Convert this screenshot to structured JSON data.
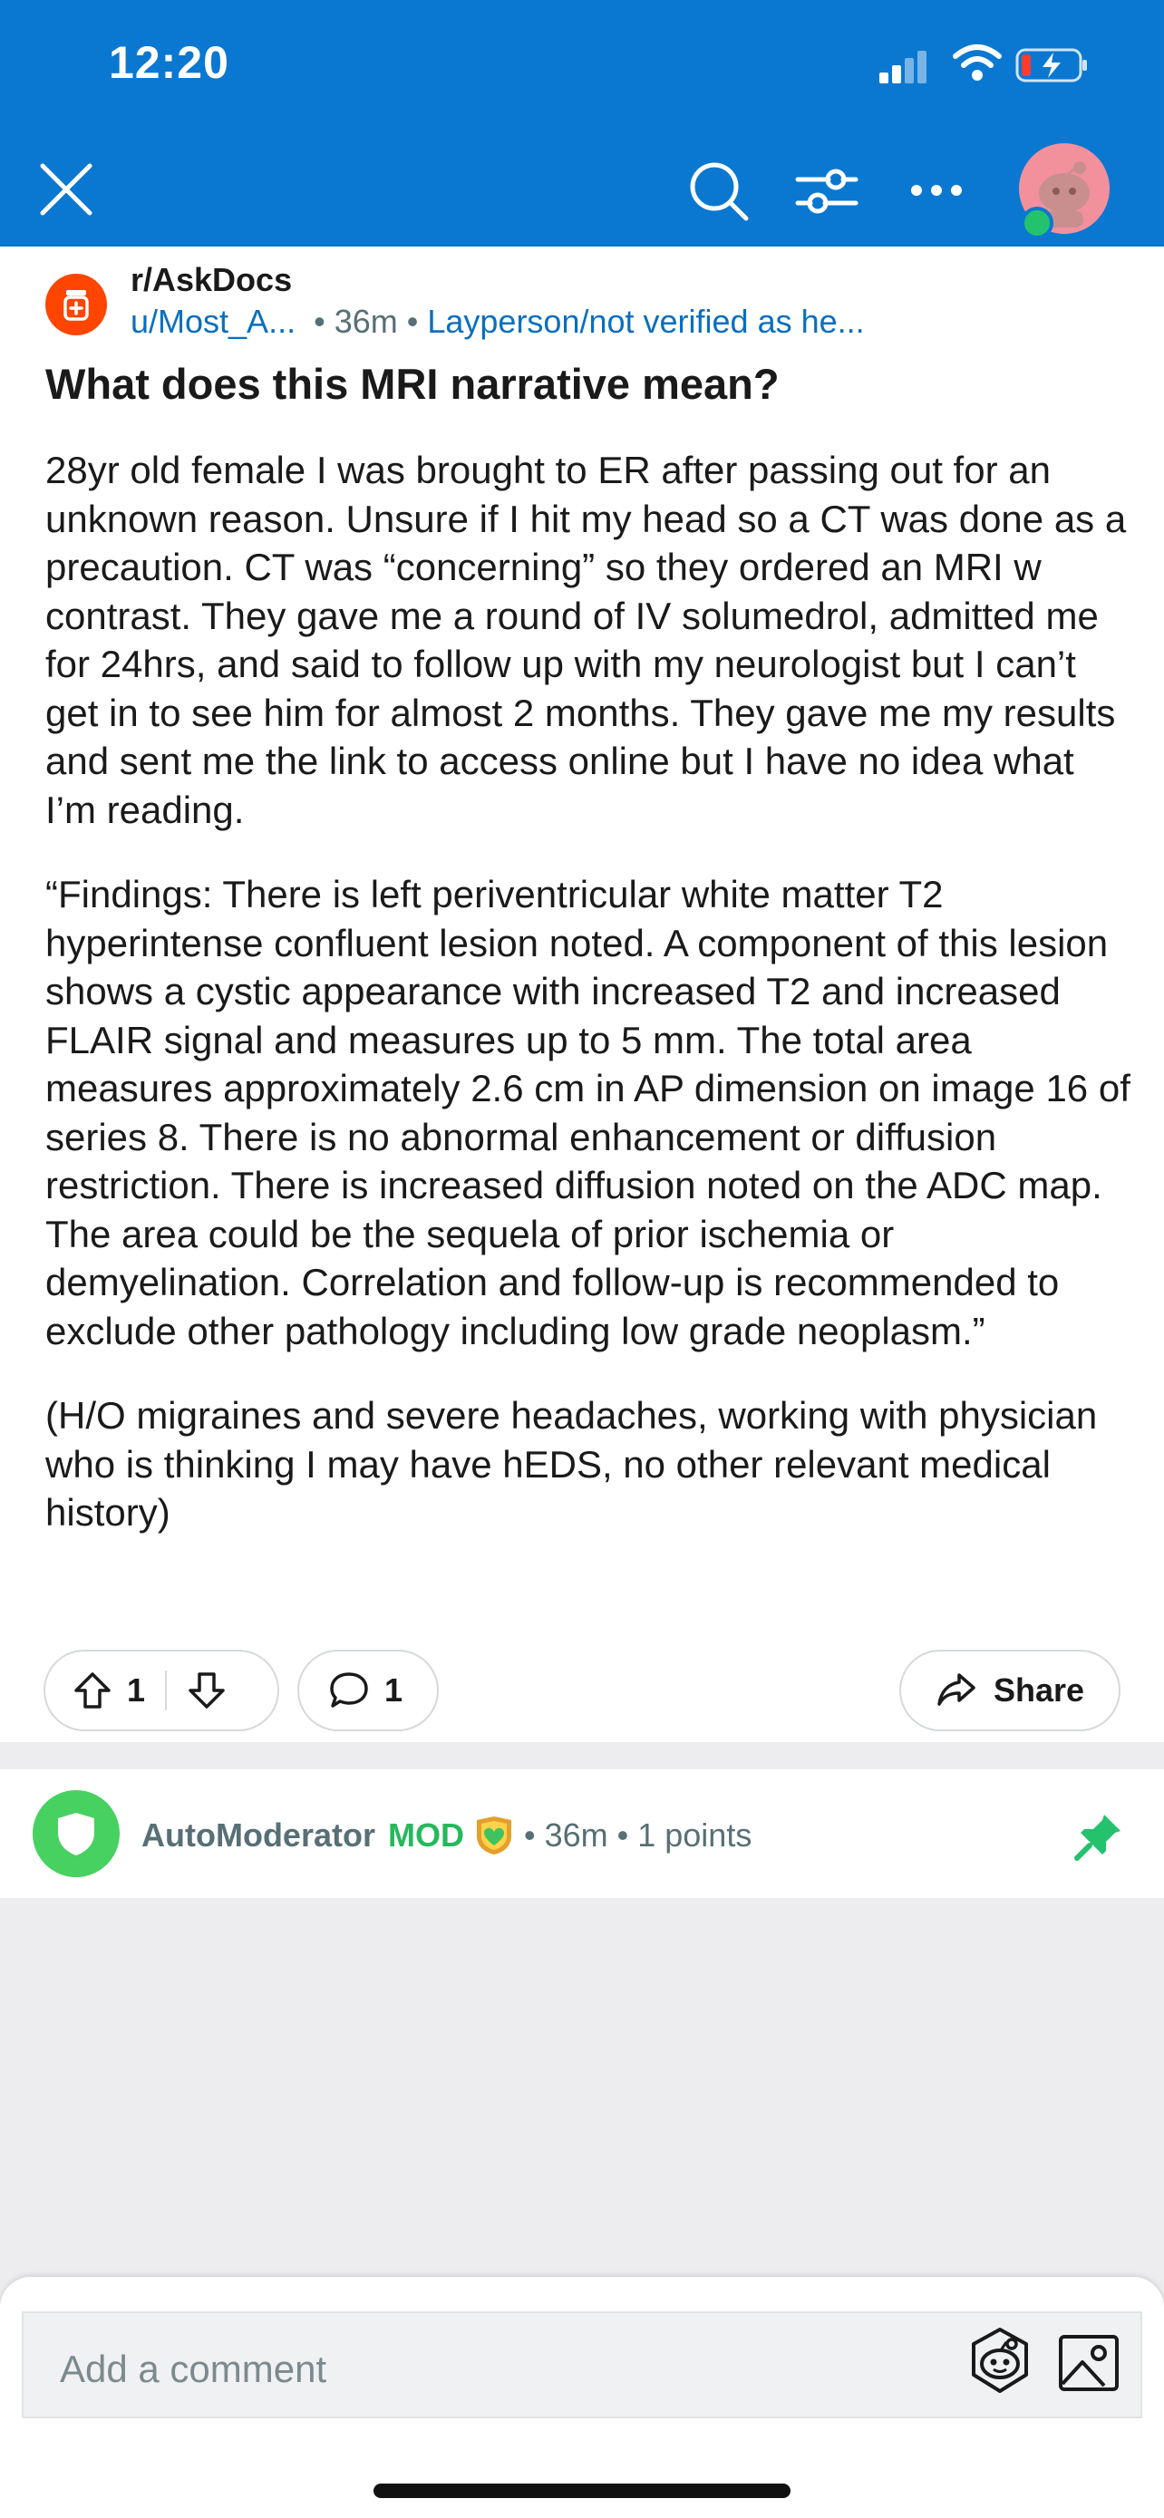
{
  "status_bar": {
    "time": "12:20"
  },
  "post": {
    "subreddit": "r/AskDocs",
    "author": "u/Most_A...",
    "age": "36m",
    "flair": "Layperson/not verified as he...",
    "title": "What does this MRI narrative mean?",
    "paragraphs": [
      "28yr old female I was brought to ER after passing out for an unknown reason. Unsure if I hit my head so a CT was done as a precaution. CT was “concerning” so they ordered an MRI w contrast. They gave me a round of IV solumedrol, admitted me for 24hrs, and said to follow up with my neurologist but I can’t get in to see him for almost 2 months. They gave me my results and sent me the link to access online but I have no idea what I’m reading.",
      "“Findings:  There is left periventricular white matter T2 hyperintense confluent lesion noted. A component of this lesion shows a cystic appearance with increased T2 and increased FLAIR signal and measures up to 5 mm. The total area measures approximately 2.6 cm in AP dimension on image 16 of series 8. There is no abnormal enhancement or diffusion restriction. There is increased diffusion noted on the ADC map. The area could be the sequela of prior ischemia or demyelination. Correlation and follow-up is recommended to exclude other pathology including low grade neoplasm.”",
      "(H/O migraines and severe headaches, working with physician who is thinking I may have hEDS, no other relevant medical history)"
    ],
    "vote_count": "1",
    "comment_count": "1",
    "share_label": "Share"
  },
  "comment": {
    "author": "AutoModerator",
    "mod_badge": "MOD",
    "age": "36m",
    "points": "1 points"
  },
  "composer": {
    "placeholder": "Add a comment"
  },
  "icons": [
    "close-icon",
    "search-icon",
    "filter-icon",
    "more-icon",
    "user-avatar",
    "subreddit-icon",
    "upvote-icon",
    "downvote-icon",
    "comment-icon",
    "share-icon",
    "shield-icon",
    "award-icon",
    "pin-icon",
    "snoo-sticker-icon",
    "image-icon"
  ],
  "colors": {
    "header": "#0a78d1",
    "accent": "#ff4500",
    "mod_green": "#25b95c",
    "link_blue": "#0a6fbf"
  }
}
